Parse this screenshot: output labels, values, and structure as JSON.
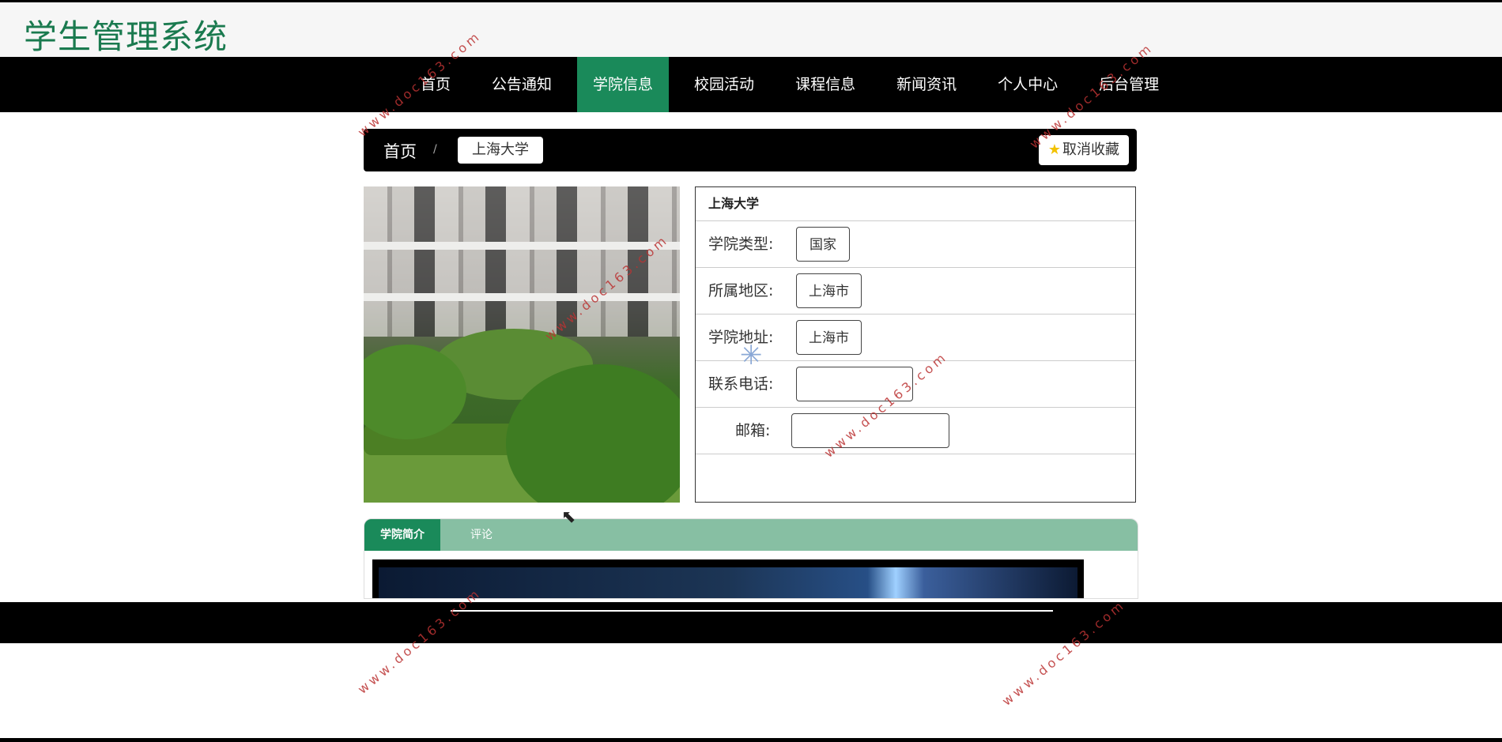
{
  "header": {
    "title": "学生管理系统"
  },
  "nav": {
    "items": [
      {
        "label": "首页"
      },
      {
        "label": "公告通知"
      },
      {
        "label": "学院信息"
      },
      {
        "label": "校园活动"
      },
      {
        "label": "课程信息"
      },
      {
        "label": "新闻资讯"
      },
      {
        "label": "个人中心"
      },
      {
        "label": "后台管理"
      }
    ],
    "active_index": 2
  },
  "breadcrumb": {
    "home": "首页",
    "separator": "/",
    "current": "上海大学"
  },
  "favorite": {
    "label": "取消收藏",
    "icon": "star-icon"
  },
  "college": {
    "name": "上海大学",
    "fields": [
      {
        "label": "学院类型:",
        "value": "国家"
      },
      {
        "label": "所属地区:",
        "value": "上海市"
      },
      {
        "label": "学院地址:",
        "value": "上海市"
      },
      {
        "label": "联系电话:",
        "value": ""
      },
      {
        "label": "邮箱:",
        "value": ""
      }
    ]
  },
  "tabs": [
    {
      "label": "学院简介"
    },
    {
      "label": "评论"
    }
  ],
  "watermark": {
    "text": "www.doc163.com"
  },
  "colors": {
    "brand_green": "#1a7a4f",
    "nav_active": "#1a8a5a",
    "tabbar": "#87bfa3"
  }
}
